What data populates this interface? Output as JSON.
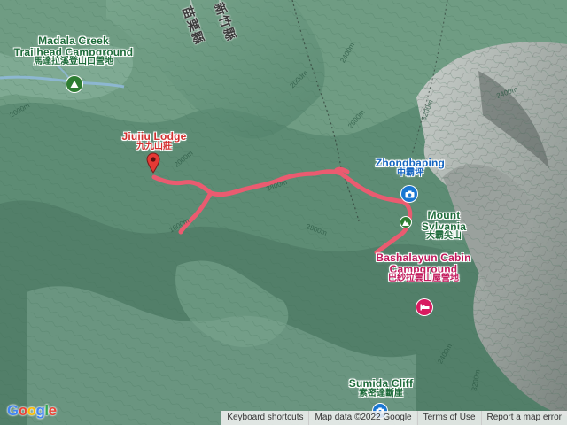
{
  "map": {
    "places": {
      "madala": {
        "en_line1": "Madala Creek",
        "en_line2": "Trailhead Campground",
        "zh": "馬達拉溪登山口營地"
      },
      "jiujiu": {
        "en": "Jiujiu Lodge",
        "zh": "九九山莊"
      },
      "zhongbaping": {
        "en": "Zhongbaping",
        "zh": "中霸坪"
      },
      "sylvania": {
        "en_line1": "Mount",
        "en_line2": "Sylvania",
        "zh": "大霸尖山"
      },
      "bashalayun": {
        "en_line1": "Bashalayun Cabin",
        "en_line2": "Campground",
        "zh": "巴紗拉雲山屋營地"
      },
      "sumida": {
        "en": "Sumida Cliff",
        "zh": "素密達斷崖"
      }
    },
    "road_labels": [
      "苗栗縣",
      "新竹縣"
    ],
    "contour_labels": [
      "2000m",
      "2000m",
      "2000m",
      "2400m",
      "2400m",
      "2800m",
      "2800m",
      "3200m",
      "2400m",
      "3200m",
      "1800m",
      "2800m"
    ],
    "icons": {
      "campground": "tent-icon",
      "viewpoint": "camera-icon",
      "lodge": "bed-icon",
      "peak": "mountain-icon",
      "start_pin": "map-pin-icon"
    },
    "route_color": "#e8506a"
  },
  "footer": {
    "logo": [
      "G",
      "o",
      "o",
      "g",
      "l",
      "e"
    ],
    "keyboard": "Keyboard shortcuts",
    "mapdata": "Map data ©2022 Google",
    "terms": "Terms of Use",
    "report": "Report a map error"
  }
}
